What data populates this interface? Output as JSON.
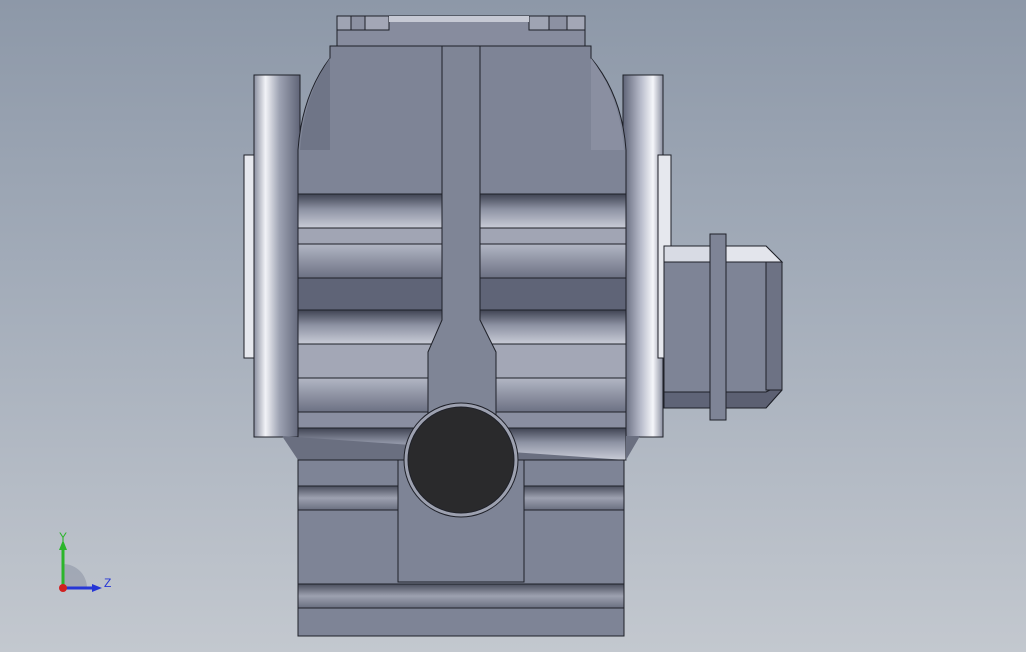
{
  "scene": {
    "subject": "gearbox-housing-front-view"
  },
  "colors": {
    "background_top": "#8d98a8",
    "background_bottom": "#c3c8cf",
    "body": "#7e8496",
    "body_light": "#9aa0b0",
    "body_dark": "#5f6477",
    "edge": "#1e2028",
    "hole": "#2a2a2c",
    "axis_x": "#d02020",
    "axis_y": "#2bb52b",
    "axis_z": "#2636d6"
  },
  "triad": {
    "y_label": "Y",
    "z_label": "Z"
  }
}
